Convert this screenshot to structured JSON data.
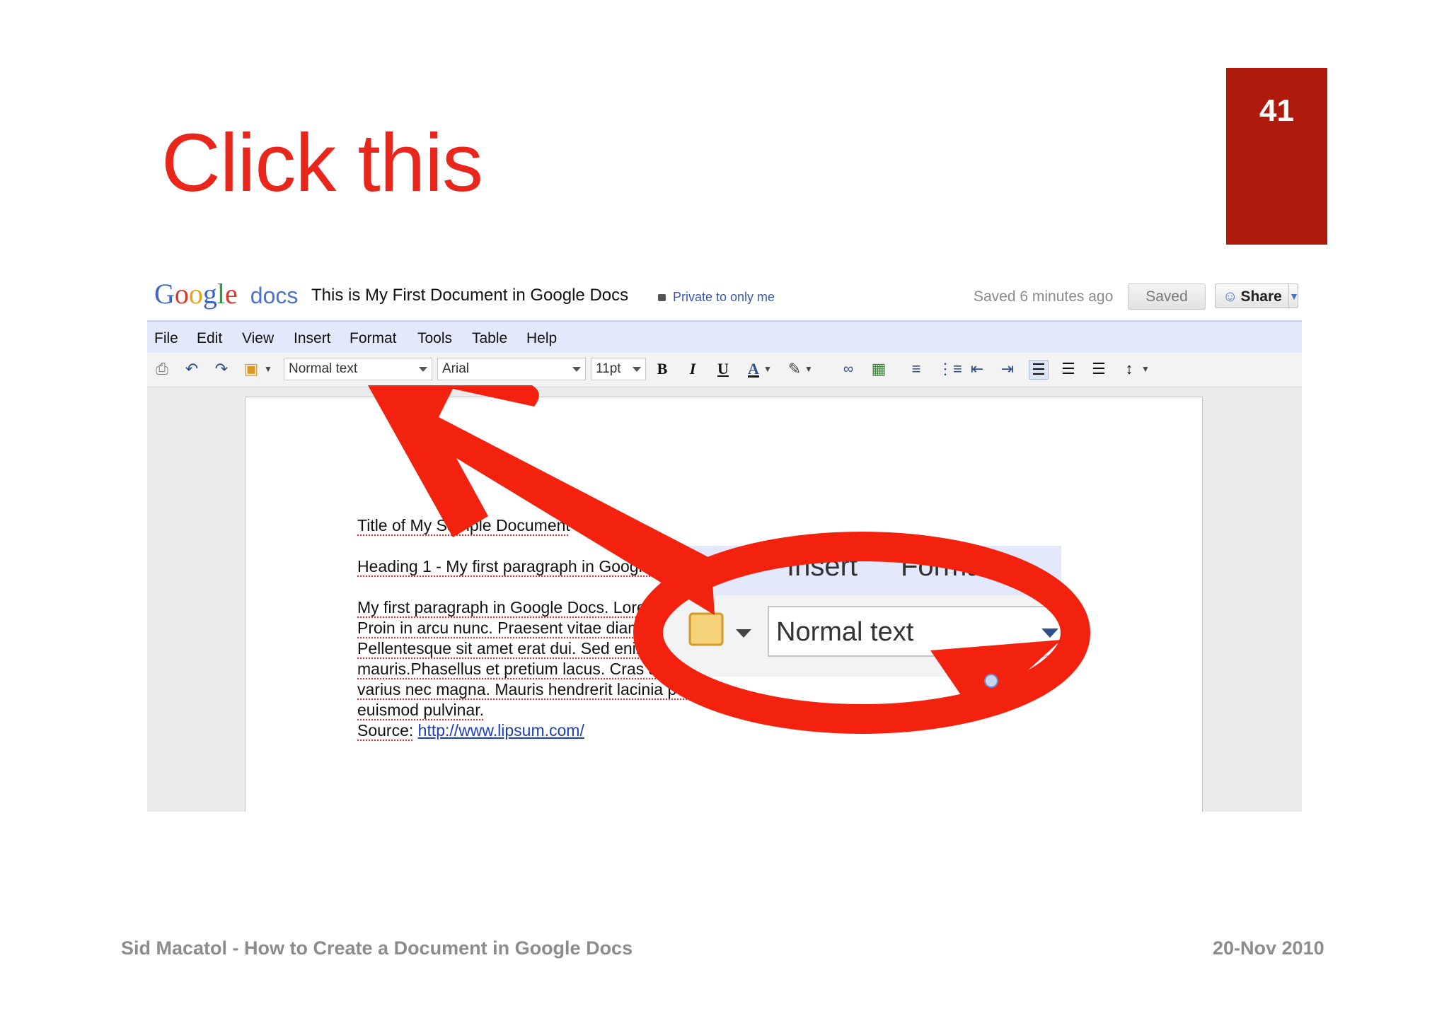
{
  "slide": {
    "title": "Click this",
    "number": "41",
    "footer_left": "Sid Macatol - How to Create a Document in Google Docs",
    "footer_right": "20-Nov 2010",
    "accent_color": "#e8261b",
    "number_bg": "#b01a0d"
  },
  "docs": {
    "logo": "Google",
    "logo_suffix": "docs",
    "doc_title": "This is My First Document in Google Docs",
    "privacy": "Private to only me",
    "saved_message": "Saved 6 minutes ago",
    "saved_button": "Saved",
    "share_button": "Share",
    "menu": [
      "File",
      "Edit",
      "View",
      "Insert",
      "Format",
      "Tools",
      "Table",
      "Help"
    ],
    "toolbar": {
      "style_select": "Normal text",
      "font_select": "Arial",
      "size_select": "11pt",
      "bold": "B",
      "italic": "I",
      "underline": "U",
      "text_color": "A"
    },
    "content": {
      "title_line": "Title of My Sample Document",
      "heading_line": "Heading 1 - My first paragraph in Google Docs",
      "para_lines": [
        "My first paragraph in Google Docs. Lorem ipsum dolor sit amet, consectetur adipiscing elit.",
        "Proin in arcu nunc. Praesent vitae diam eget purus porttitor aliquet quis in lorem.",
        "Pellentesque sit amet erat dui. Sed enim odio, molestie sit amet tempus sed, ornare ac",
        "mauris.Phasellus et pretium lacus. Cras at libero quam, sit amet scelerisque orci. Nunc lacinia id,",
        "varius nec magna. Mauris hendrerit lacinia purus eu suscipit. Vestibulum et enim id urna",
        "euismod pulvinar."
      ],
      "source_label": "Source:",
      "source_link": "http://www.lipsum.com/"
    },
    "zoom": {
      "menu_partial_1": "Insert",
      "menu_partial_2": "Format",
      "style_select": "Normal text"
    }
  }
}
